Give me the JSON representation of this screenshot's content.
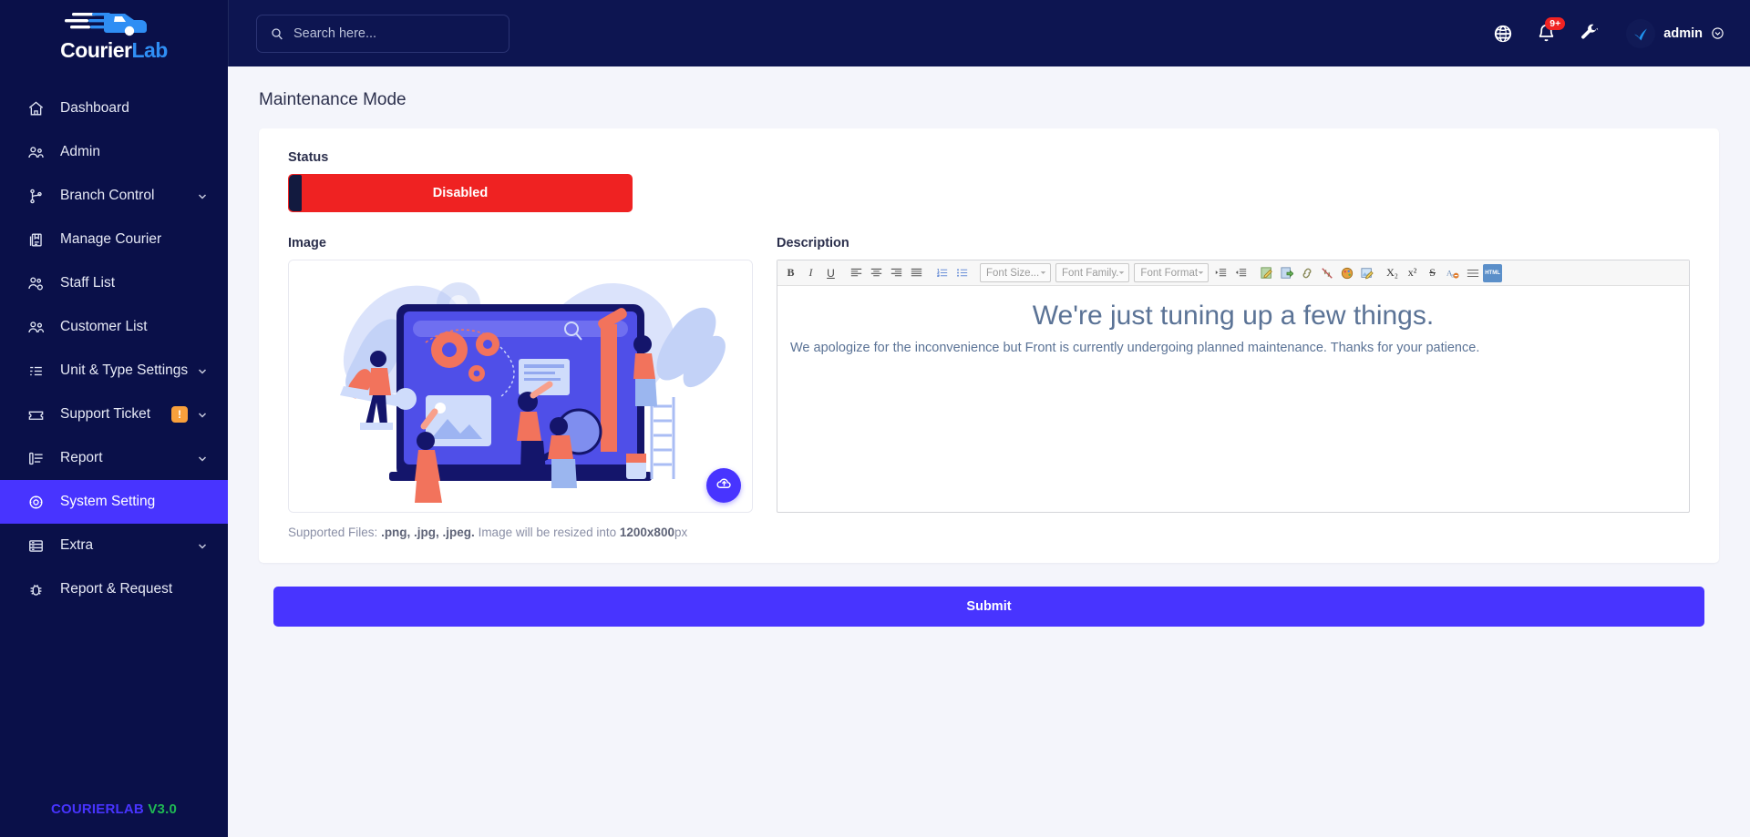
{
  "brand": {
    "name_part1": "Courier",
    "name_part2": "Lab",
    "logo_icon": "courier-truck-logo"
  },
  "sidebar": {
    "items": [
      {
        "label": "Dashboard",
        "icon": "home-icon",
        "expandable": false,
        "active": false,
        "badge": null
      },
      {
        "label": "Admin",
        "icon": "users-group-icon",
        "expandable": false,
        "active": false,
        "badge": null
      },
      {
        "label": "Branch Control",
        "icon": "branch-icon",
        "expandable": true,
        "active": false,
        "badge": null
      },
      {
        "label": "Manage Courier",
        "icon": "parcel-icon",
        "expandable": false,
        "active": false,
        "badge": null
      },
      {
        "label": "Staff List",
        "icon": "users-cog-icon",
        "expandable": false,
        "active": false,
        "badge": null
      },
      {
        "label": "Customer List",
        "icon": "users-icon",
        "expandable": false,
        "active": false,
        "badge": null
      },
      {
        "label": "Unit & Type Settings",
        "icon": "sort-list-icon",
        "expandable": true,
        "active": false,
        "badge": null
      },
      {
        "label": "Support Ticket",
        "icon": "ticket-icon",
        "expandable": true,
        "active": false,
        "badge": "!"
      },
      {
        "label": "Report",
        "icon": "report-list-icon",
        "expandable": true,
        "active": false,
        "badge": null
      },
      {
        "label": "System Setting",
        "icon": "gear-circle-icon",
        "expandable": false,
        "active": true,
        "badge": null
      },
      {
        "label": "Extra",
        "icon": "server-icon",
        "expandable": true,
        "active": false,
        "badge": null
      },
      {
        "label": "Report & Request",
        "icon": "bug-icon",
        "expandable": false,
        "active": false,
        "badge": null
      }
    ],
    "footer": {
      "app_name": "COURIERLAB",
      "version": "V3.0"
    }
  },
  "topbar": {
    "search": {
      "placeholder": "Search here...",
      "value": "",
      "icon": "search-icon"
    },
    "language_icon": "globe-icon",
    "notification": {
      "icon": "bell-icon",
      "count": "9+"
    },
    "tools_icon": "wrench-icon",
    "user": {
      "name": "admin",
      "avatar_icon": "verified-check-avatar",
      "chevron": "chevron-down-icon"
    }
  },
  "page": {
    "title": "Maintenance Mode",
    "status": {
      "label": "Status",
      "toggle_text": "Disabled",
      "enabled": false,
      "color": "#ef2222"
    },
    "image": {
      "label": "Image",
      "alt": "maintenance-illustration",
      "upload_icon": "cloud-upload-icon",
      "help_prefix": "Supported Files: ",
      "help_formats": ".png, .jpg, .jpeg.",
      "help_middle": " Image will be resized into ",
      "help_size": "1200x800",
      "help_suffix": "px"
    },
    "description": {
      "label": "Description",
      "toolbar": {
        "buttons": [
          {
            "name": "bold-icon",
            "glyph": "B"
          },
          {
            "name": "italic-icon",
            "glyph": "I"
          },
          {
            "name": "underline-icon",
            "glyph": "U"
          },
          {
            "name": "align-left-icon",
            "glyph": "≡"
          },
          {
            "name": "align-center-icon",
            "glyph": "≡"
          },
          {
            "name": "align-right-icon",
            "glyph": "≡"
          },
          {
            "name": "align-justify-icon",
            "glyph": "≡"
          },
          {
            "name": "numbered-list-icon",
            "glyph": "≔"
          },
          {
            "name": "bulleted-list-icon",
            "glyph": "≔"
          }
        ],
        "selects": [
          {
            "name": "font-size-select",
            "value": "Font Size..."
          },
          {
            "name": "font-family-select",
            "value": "Font Family."
          },
          {
            "name": "font-format-select",
            "value": "Font Format"
          }
        ],
        "buttons2": [
          {
            "name": "increase-indent-icon",
            "glyph": "⇥"
          },
          {
            "name": "decrease-indent-icon",
            "glyph": "⇤"
          },
          {
            "name": "edit-source-icon",
            "glyph": "✎"
          },
          {
            "name": "paste-icon",
            "glyph": "⬒"
          },
          {
            "name": "link-icon",
            "glyph": "🔗"
          },
          {
            "name": "unlink-icon",
            "glyph": "⛓"
          },
          {
            "name": "text-color-icon",
            "glyph": "🎨"
          },
          {
            "name": "image-edit-icon",
            "glyph": "🖼"
          },
          {
            "name": "subscript-icon",
            "glyph": "X₂"
          },
          {
            "name": "superscript-icon",
            "glyph": "x²"
          },
          {
            "name": "strikethrough-icon",
            "glyph": "S"
          },
          {
            "name": "remove-format-icon",
            "glyph": "A"
          },
          {
            "name": "horizontal-rule-icon",
            "glyph": "≡"
          },
          {
            "name": "html-source-icon",
            "glyph": "HTML"
          }
        ]
      },
      "heading": "We're just tuning up a few things.",
      "paragraph": "We apologize for the inconvenience but Front is currently undergoing planned maintenance. Thanks for your patience."
    },
    "submit_label": "Submit"
  }
}
